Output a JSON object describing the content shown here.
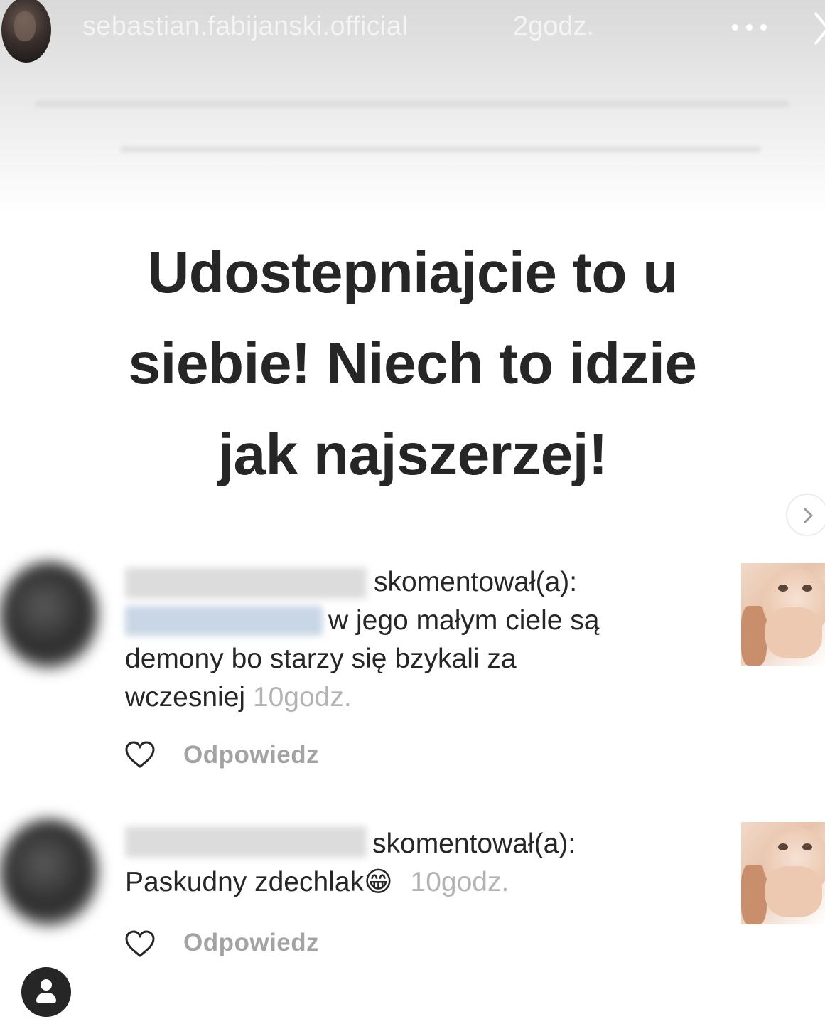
{
  "story": {
    "username": "sebastian.fabijanski.official",
    "time_ago": "2godz.",
    "more_icon": "more-horizontal-icon",
    "close_icon": "close-icon",
    "headline_lines": [
      "Udostepniajcie to u",
      "siebie! Niech to idzie",
      "jak najszerzej!"
    ],
    "next_icon": "chevron-right-icon"
  },
  "comments": [
    {
      "verb": "skomentował(a):",
      "text_first_line": "w jego małym ciele są",
      "text_rest": "demony bo starzy się bzykali za wczesniej",
      "time": "10godz.",
      "reply_label": "Odpowiedz",
      "like_icon": "heart-outline-icon"
    },
    {
      "verb": "skomentował(a):",
      "text": "Paskudny zdechlak😁",
      "time": "10godz.",
      "reply_label": "Odpowiedz",
      "like_icon": "heart-outline-icon"
    }
  ],
  "bottom": {
    "profile_icon": "profile-icon"
  },
  "colors": {
    "text": "#262626",
    "muted": "#b3b3b3",
    "reply": "#a3a3a3"
  }
}
